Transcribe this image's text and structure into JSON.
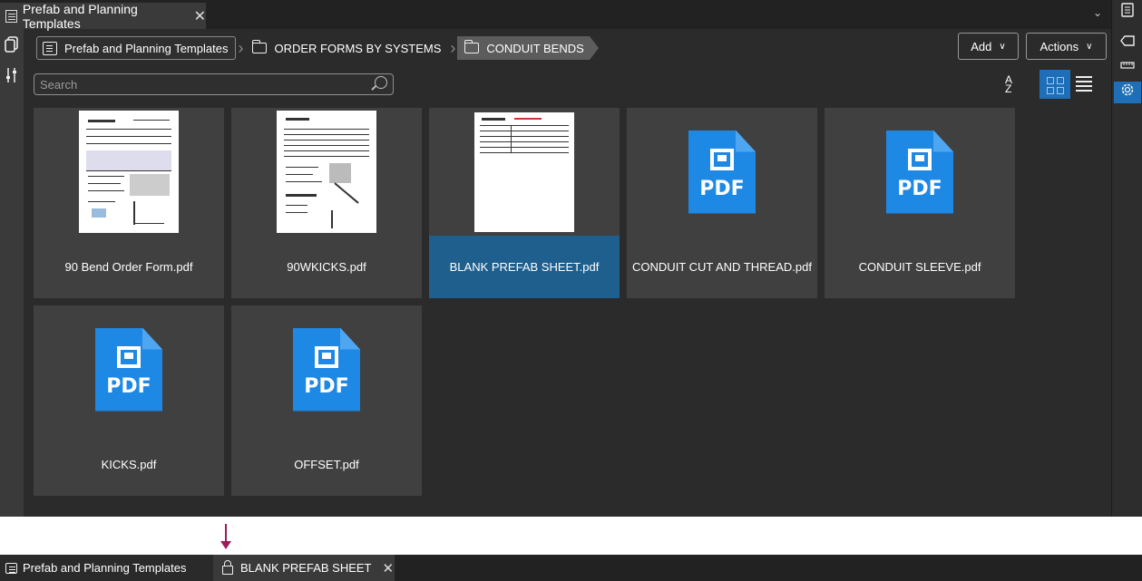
{
  "window": {
    "tab_title": "Prefab and Planning Templates",
    "close_symbol": "✕",
    "chevron_symbol": "⌄"
  },
  "breadcrumb": {
    "root": "Prefab and Planning Templates",
    "level1": "ORDER FORMS BY SYSTEMS",
    "level2": "CONDUIT BENDS"
  },
  "toolbar": {
    "add_label": "Add",
    "actions_label": "Actions",
    "search_placeholder": "Search",
    "sort_icon": "sort-az-icon",
    "view_mode": "grid"
  },
  "files": [
    {
      "name": "90 Bend Order Form.pdf",
      "thumb": "preview",
      "selected": false
    },
    {
      "name": "90WKICKS.pdf",
      "thumb": "preview",
      "selected": false
    },
    {
      "name": "BLANK PREFAB SHEET.pdf",
      "thumb": "preview",
      "selected": true
    },
    {
      "name": "CONDUIT CUT AND THREAD.pdf",
      "thumb": "pdf-icon",
      "selected": false
    },
    {
      "name": "CONDUIT SLEEVE.pdf",
      "thumb": "pdf-icon",
      "selected": false
    },
    {
      "name": "KICKS.pdf",
      "thumb": "pdf-icon",
      "selected": false
    },
    {
      "name": "OFFSET.pdf",
      "thumb": "pdf-icon",
      "selected": false
    }
  ],
  "pdf_icon_text": "PDF",
  "bottom_tabs": {
    "tab1": "Prefab and Planning Templates",
    "tab2": "BLANK PREFAB SHEET",
    "close_symbol": "✕"
  },
  "colors": {
    "accent": "#1e6fb8",
    "selected_tile": "#1e5f8e",
    "pdf_blue": "#1e88e5",
    "annotation_arrow": "#a0195a"
  }
}
